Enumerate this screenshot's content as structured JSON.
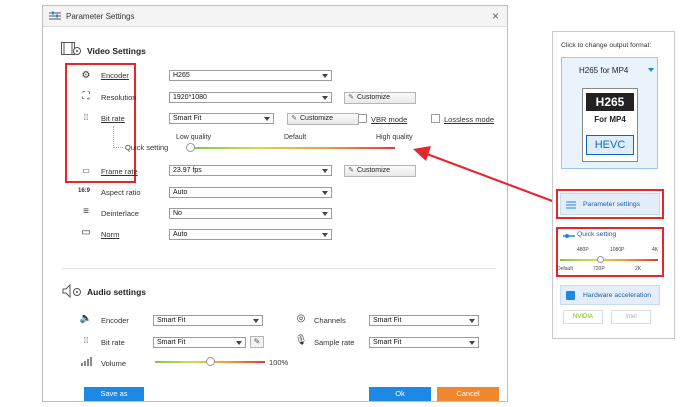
{
  "dialog": {
    "title": "Parameter Settings",
    "close": "×",
    "video_section": "Video Settings",
    "audio_section": "Audio settings",
    "video": {
      "encoder": {
        "label": "Encoder",
        "value": "H265"
      },
      "resolution": {
        "label": "Resolution",
        "value": "1920*1080",
        "customize": "Customize"
      },
      "bitrate": {
        "label": "Bit rate",
        "value": "Smart Fit",
        "customize": "Customize",
        "vbr": "VBR mode",
        "lossless": "Lossless mode"
      },
      "quick_setting": {
        "label": "Quick setting",
        "low": "Low quality",
        "default": "Default",
        "high": "High quality"
      },
      "framerate": {
        "label": "Frame rate",
        "value": "23.97 fps",
        "customize": "Customize"
      },
      "aspect": {
        "label": "Aspect ratio",
        "value": "Auto"
      },
      "deinterlace": {
        "label": "Deinterlace",
        "value": "No"
      },
      "norm": {
        "label": "Norm",
        "value": "Auto"
      }
    },
    "audio": {
      "encoder": {
        "label": "Encoder",
        "value": "Smart Fit"
      },
      "channels": {
        "label": "Channels",
        "value": "Smart Fit"
      },
      "bitrate": {
        "label": "Bit rate",
        "value": "Smart Fit"
      },
      "sample_rate": {
        "label": "Sample rate",
        "value": "Smart Fit"
      },
      "volume": {
        "label": "Volume",
        "value": "100%",
        "level": 0.5
      }
    },
    "footer": {
      "save_as": "Save as",
      "ok": "Ok",
      "cancel": "Cancel"
    }
  },
  "right_panel": {
    "heading": "Click to change output format:",
    "format_name": "H265 for MP4",
    "format_icon_top": "H265",
    "format_icon_mid": "For MP4",
    "format_icon_bottom": "HEVC",
    "param_settings": "Parameter settings",
    "quick_setting": "Quick setting",
    "qs_top": [
      "480P",
      "1080P",
      "4K"
    ],
    "qs_bottom": [
      "Default",
      "720P",
      "2K"
    ],
    "hw_accel": "Hardware acceleration",
    "nvidia": "NVIDIA",
    "intel": "Intel"
  },
  "colors": {
    "accent": "#1e88e5",
    "highlight": "#e5272d",
    "ok_button": "#1e88e5",
    "cancel_button": "#f0862e"
  }
}
